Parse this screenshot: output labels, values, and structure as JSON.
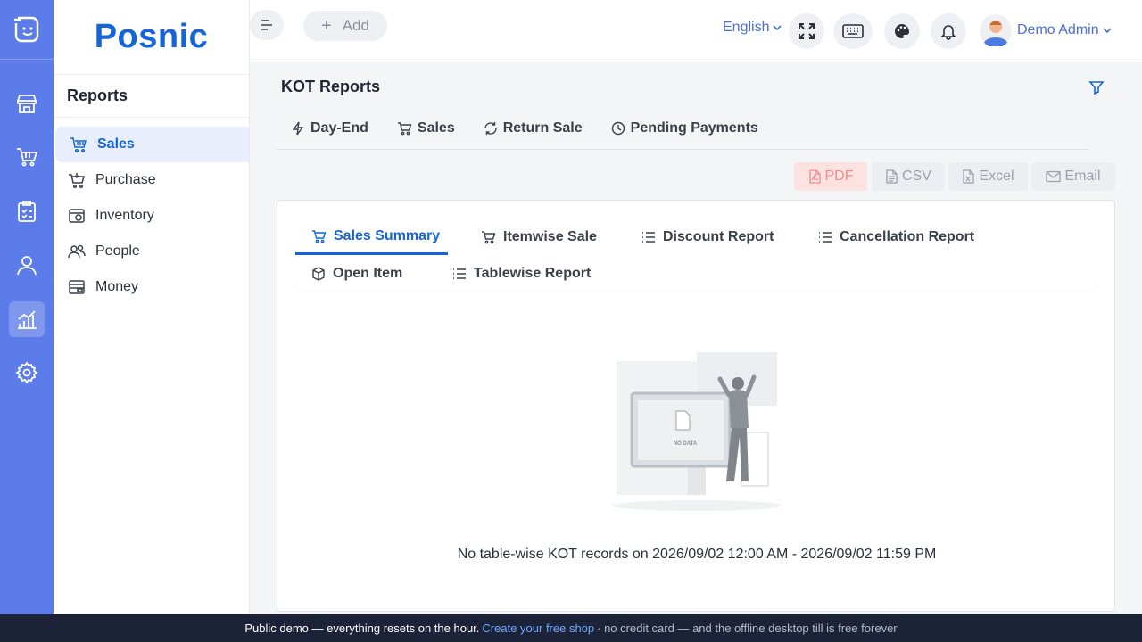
{
  "brand": {
    "name": "Posnic"
  },
  "submenu": {
    "title": "Reports",
    "items": [
      {
        "label": "Sales",
        "icon": "basket-icon",
        "active": true
      },
      {
        "label": "Purchase",
        "icon": "cart-icon",
        "active": false
      },
      {
        "label": "Inventory",
        "icon": "box-icon",
        "active": false
      },
      {
        "label": "People",
        "icon": "users-icon",
        "active": false
      },
      {
        "label": "Money",
        "icon": "money-icon",
        "active": false
      }
    ]
  },
  "rail": {
    "items": [
      "store-icon",
      "cart-icon",
      "clipboard-icon",
      "user-icon",
      "chart-icon",
      "gear-icon"
    ],
    "active": "chart-icon"
  },
  "topbar": {
    "add_label": "Add",
    "language": "English",
    "user": "Demo Admin"
  },
  "page": {
    "title": "KOT Reports"
  },
  "report_tabs": [
    {
      "label": "Day-End",
      "icon": "bolt-icon"
    },
    {
      "label": "Sales",
      "icon": "cart-icon"
    },
    {
      "label": "Return Sale",
      "icon": "refresh-icon"
    },
    {
      "label": "Pending Payments",
      "icon": "clock-icon"
    }
  ],
  "export": {
    "pdf": "PDF",
    "csv": "CSV",
    "excel": "Excel",
    "email": "Email"
  },
  "inner_tabs": [
    {
      "label": "Sales Summary",
      "icon": "cart-icon",
      "active": true
    },
    {
      "label": "Itemwise Sale",
      "icon": "cart-icon",
      "active": false
    },
    {
      "label": "Discount Report",
      "icon": "list-icon",
      "active": false
    },
    {
      "label": "Cancellation Report",
      "icon": "list-icon",
      "active": false
    },
    {
      "label": "Open Item",
      "icon": "cube-icon",
      "active": false
    },
    {
      "label": "Tablewise Report",
      "icon": "list-icon",
      "active": false
    }
  ],
  "empty": {
    "illustration_text": "NO DATA",
    "message": "No table-wise KOT records on 2026/09/02 12:00 AM - 2026/09/02 11:59 PM"
  },
  "footer": {
    "lead": "Public demo — everything resets on the hour.",
    "link": "Create your free shop",
    "tail": "· no credit card — and the offline desktop till is free forever"
  },
  "colors": {
    "accent": "#1565d8",
    "rail": "#5c7cea",
    "footer": "#1c2238"
  }
}
